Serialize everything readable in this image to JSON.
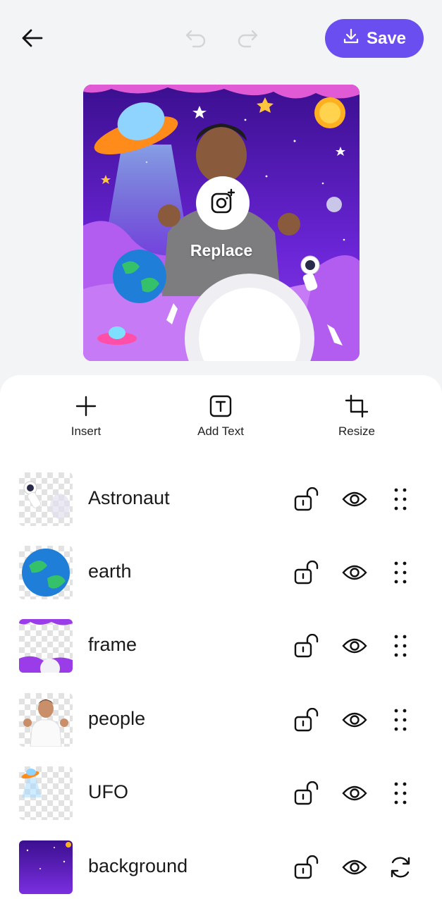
{
  "header": {
    "save_label": "Save"
  },
  "canvas": {
    "replace_label": "Replace"
  },
  "tools": [
    {
      "label": "Insert",
      "icon": "plus-icon"
    },
    {
      "label": "Add Text",
      "icon": "text-box-icon"
    },
    {
      "label": "Resize",
      "icon": "crop-icon"
    }
  ],
  "layers": [
    {
      "name": "Astronaut",
      "trailing_icon": "drag-handle-icon"
    },
    {
      "name": "earth",
      "trailing_icon": "drag-handle-icon"
    },
    {
      "name": "frame",
      "trailing_icon": "drag-handle-icon"
    },
    {
      "name": "people",
      "trailing_icon": "drag-handle-icon"
    },
    {
      "name": "UFO",
      "trailing_icon": "drag-handle-icon"
    },
    {
      "name": "background",
      "trailing_icon": "replace-cycle-icon"
    }
  ],
  "colors": {
    "accent": "#6b4ef0",
    "canvas_purple": "#5a1fc2"
  }
}
